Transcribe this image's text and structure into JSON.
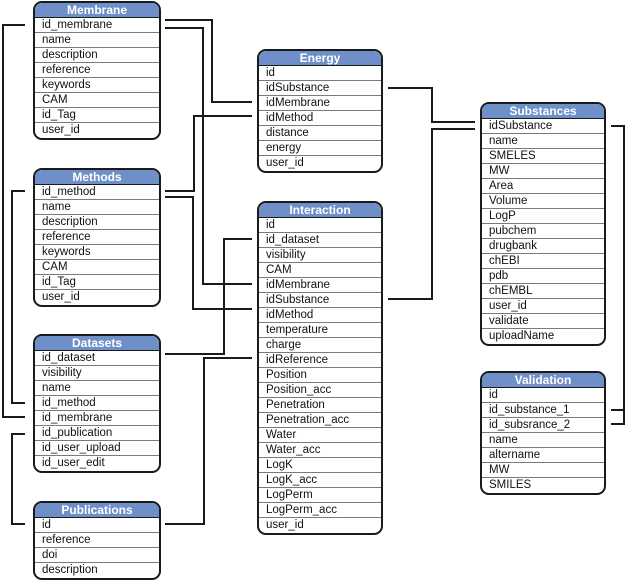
{
  "diagram": {
    "type": "database-schema",
    "tables": {
      "membrane": {
        "title": "Membrane",
        "fields": [
          "id_membrane",
          "name",
          "description",
          "reference",
          "keywords",
          "CAM",
          "id_Tag",
          "user_id"
        ]
      },
      "methods": {
        "title": "Methods",
        "fields": [
          "id_method",
          "name",
          "description",
          "reference",
          "keywords",
          "CAM",
          "id_Tag",
          "user_id"
        ]
      },
      "datasets": {
        "title": "Datasets",
        "fields": [
          "id_dataset",
          "visibility",
          "name",
          "id_method",
          "id_membrane",
          "id_publication",
          "id_user_upload",
          "id_user_edit"
        ]
      },
      "publications": {
        "title": "Publications",
        "fields": [
          "id",
          "reference",
          "doi",
          "description"
        ]
      },
      "energy": {
        "title": "Energy",
        "fields": [
          "id",
          "idSubstance",
          "idMembrane",
          "idMethod",
          "distance",
          "energy",
          "user_id"
        ]
      },
      "interaction": {
        "title": "Interaction",
        "fields": [
          "id",
          "id_dataset",
          "visibility",
          "CAM",
          "idMembrane",
          "idSubstance",
          "idMethod",
          "temperature",
          "charge",
          "idReference",
          "Position",
          "Position_acc",
          "Penetration",
          "Penetration_acc",
          "Water",
          "Water_acc",
          "LogK",
          "LogK_acc",
          "LogPerm",
          "LogPerm_acc",
          "user_id"
        ]
      },
      "substances": {
        "title": "Substances",
        "fields": [
          "idSubstance",
          "name",
          "SMELES",
          "MW",
          "Area",
          "Volume",
          "LogP",
          "pubchem",
          "drugbank",
          "chEBI",
          "pdb",
          "chEMBL",
          "user_id",
          "validate",
          "uploadName"
        ]
      },
      "validation": {
        "title": "Validation",
        "fields": [
          "id",
          "id_substance_1",
          "id_subsrance_2",
          "name",
          "altername",
          "MW",
          "SMILES"
        ]
      }
    },
    "relations": [
      {
        "from": "membrane.id_membrane",
        "to": "energy.idMembrane"
      },
      {
        "from": "membrane.id_membrane",
        "to": "interaction.idMembrane"
      },
      {
        "from": "membrane.id_membrane",
        "to": "datasets.id_membrane"
      },
      {
        "from": "methods.id_method",
        "to": "energy.idMethod"
      },
      {
        "from": "methods.id_method",
        "to": "interaction.idMethod"
      },
      {
        "from": "methods.id_method",
        "to": "datasets.id_method"
      },
      {
        "from": "datasets.id_dataset",
        "to": "interaction.id_dataset"
      },
      {
        "from": "publications.id",
        "to": "datasets.id_publication"
      },
      {
        "from": "publications.id",
        "to": "interaction.idReference"
      },
      {
        "from": "substances.idSubstance",
        "to": "energy.idSubstance"
      },
      {
        "from": "substances.idSubstance",
        "to": "interaction.idSubstance"
      },
      {
        "from": "substances.idSubstance",
        "to": "validation.id_substance_1"
      },
      {
        "from": "substances.idSubstance",
        "to": "validation.id_subsrance_2"
      }
    ],
    "colors": {
      "header": "#6f8fc9",
      "header_text": "#ffffff",
      "border": "#1a1a1a",
      "wire": "#1a1a1a"
    }
  }
}
